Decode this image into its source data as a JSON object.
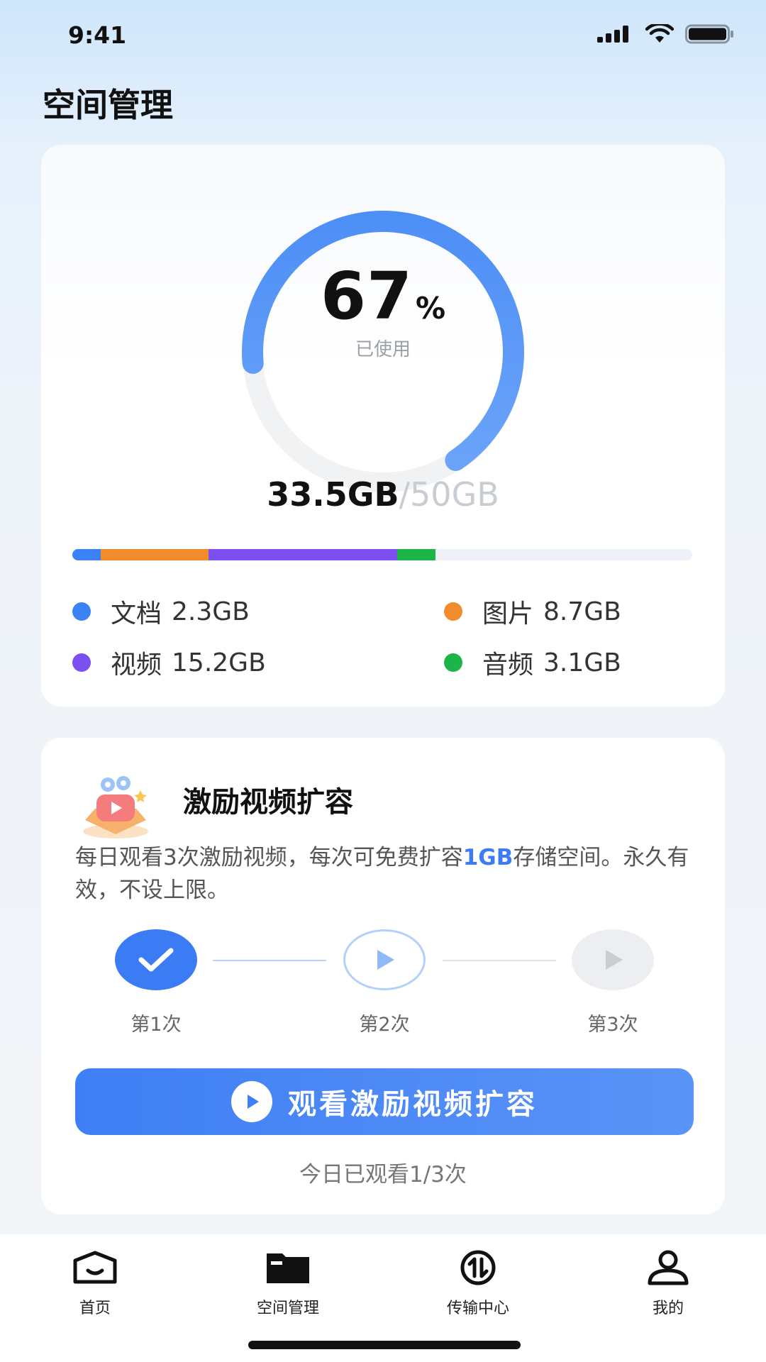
{
  "status_bar": {
    "time": "9:41"
  },
  "page_title": "空间管理",
  "storage": {
    "percent": "67",
    "percent_unit": "%",
    "percent_caption": "已使用",
    "used_label": "33.5GB",
    "total_label": "/50GB",
    "used_fraction": 0.67,
    "categories": [
      {
        "name": "文档",
        "size": "2.3GB",
        "gb": 2.3,
        "color": "#3b82f6"
      },
      {
        "name": "图片",
        "size": "8.7GB",
        "gb": 8.7,
        "color": "#f28a2e"
      },
      {
        "name": "视频",
        "size": "15.2GB",
        "gb": 15.2,
        "color": "#7b4ff0"
      },
      {
        "name": "音频",
        "size": "3.1GB",
        "gb": 3.1,
        "color": "#1db44a"
      }
    ],
    "total_gb": 50
  },
  "reward": {
    "title": "激励视频扩容",
    "desc_before": "每日观看3次激励视频，每次可免费扩容",
    "desc_highlight": "1GB",
    "desc_after": "存储空间。永久有效，不设上限。",
    "steps": [
      {
        "label": "第1次",
        "state": "done"
      },
      {
        "label": "第2次",
        "state": "current"
      },
      {
        "label": "第3次",
        "state": "locked"
      }
    ],
    "button_label": "观看激励视频扩容",
    "watched_text": "今日已观看1/3次"
  },
  "tabs": [
    {
      "label": "首页",
      "icon": "home-icon"
    },
    {
      "label": "空间管理",
      "icon": "folder-icon",
      "active": true
    },
    {
      "label": "传输中心",
      "icon": "transfer-icon"
    },
    {
      "label": "我的",
      "icon": "user-icon"
    }
  ],
  "colors": {
    "accent": "#3b7cf5",
    "track": "#eef2f7"
  }
}
